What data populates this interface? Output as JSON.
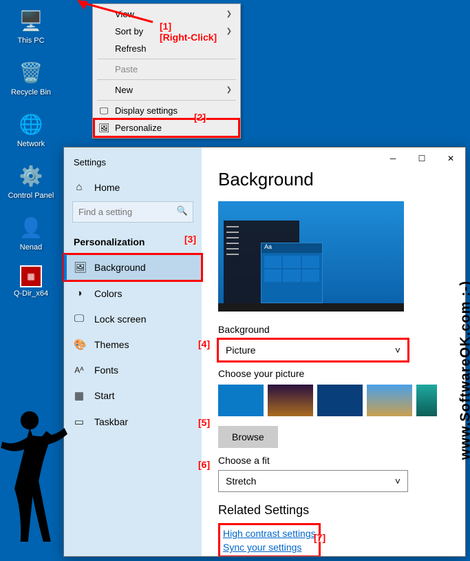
{
  "desktop": {
    "icons": [
      {
        "label": "This PC"
      },
      {
        "label": "Recycle Bin"
      },
      {
        "label": "Network"
      },
      {
        "label": "Control Panel"
      },
      {
        "label": "Nenad"
      },
      {
        "label": "Q-Dir_x64"
      }
    ]
  },
  "context_menu": {
    "view": "View",
    "sort_by": "Sort by",
    "refresh": "Refresh",
    "paste": "Paste",
    "new": "New",
    "display_settings": "Display settings",
    "personalize": "Personalize"
  },
  "annotations": {
    "a1": "[1]",
    "a1b": "[Right-Click]",
    "a2": "[2]",
    "a3": "[3]",
    "a4": "[4]",
    "a5": "[5]",
    "a6": "[6]",
    "a7": "[7]"
  },
  "settings": {
    "app_title": "Settings",
    "home": "Home",
    "search_placeholder": "Find a setting",
    "category": "Personalization",
    "nav": {
      "background": "Background",
      "colors": "Colors",
      "lock_screen": "Lock screen",
      "themes": "Themes",
      "fonts": "Fonts",
      "start": "Start",
      "taskbar": "Taskbar"
    },
    "page": {
      "title": "Background",
      "preview_aa": "Aa",
      "label_background": "Background",
      "dd_background": "Picture",
      "label_choose_picture": "Choose your picture",
      "browse": "Browse",
      "label_choose_fit": "Choose a fit",
      "dd_fit": "Stretch",
      "related_heading": "Related Settings",
      "link_highcontrast": "High contrast settings",
      "link_sync": "Sync your settings"
    }
  },
  "watermark": "www.SoftwareOK.com :-)"
}
